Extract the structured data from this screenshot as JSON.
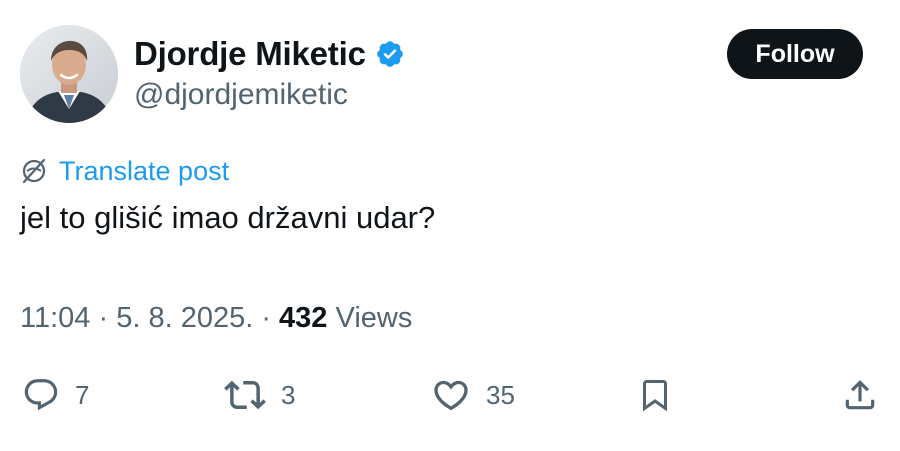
{
  "author": {
    "display_name": "Djordje Miketic",
    "handle": "@djordjemiketic",
    "verified": true,
    "avatar_icon": "profile-photo"
  },
  "follow_button": {
    "label": "Follow"
  },
  "translate": {
    "label": "Translate post",
    "icon": "globe-slash-icon"
  },
  "post": {
    "text": "jel to glišić imao državni udar?"
  },
  "meta": {
    "time": "11:04",
    "separator1": " · ",
    "date": "5. 8. 2025.",
    "separator2": " · ",
    "views_count": "432",
    "views_label": " Views"
  },
  "actions": {
    "reply": {
      "icon": "reply-icon",
      "count": "7"
    },
    "retweet": {
      "icon": "retweet-icon",
      "count": "3"
    },
    "like": {
      "icon": "heart-icon",
      "count": "35"
    },
    "bookmark": {
      "icon": "bookmark-icon"
    },
    "share": {
      "icon": "share-icon"
    }
  },
  "colors": {
    "text_primary": "#0f1419",
    "text_secondary": "#536471",
    "accent_blue": "#1d9bf0",
    "follow_bg": "#0f1419"
  }
}
